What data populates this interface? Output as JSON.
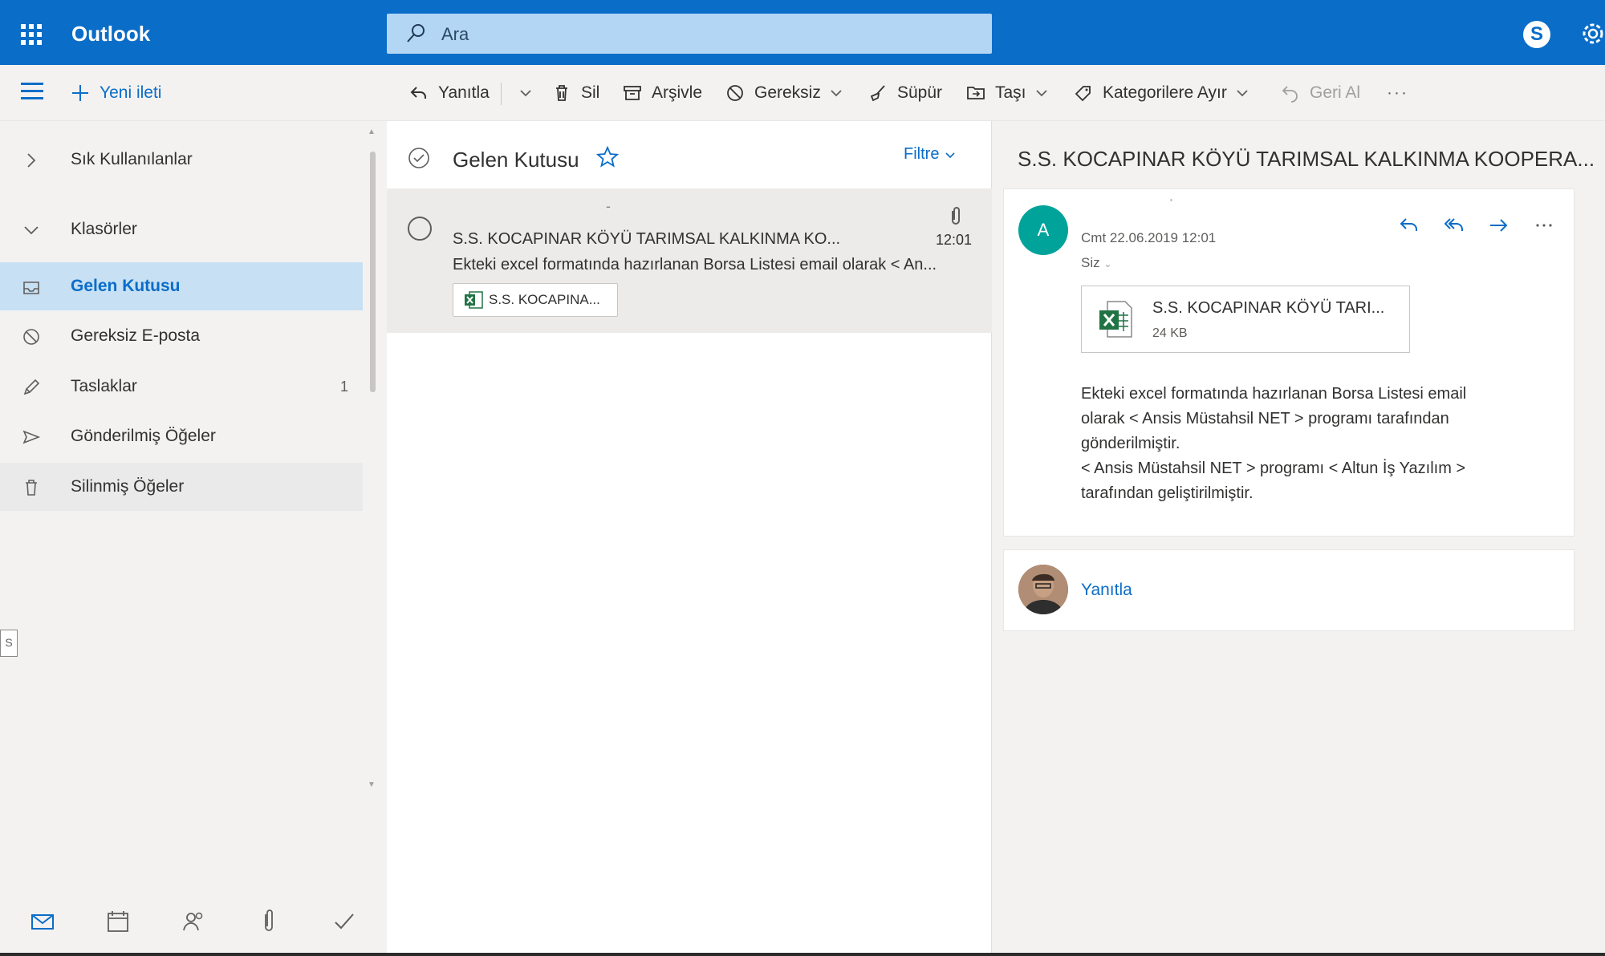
{
  "topbar": {
    "app_name": "Outlook",
    "search_placeholder": "Ara",
    "icons": [
      "app-launcher-icon",
      "search-icon",
      "skype-icon",
      "settings-gear-icon"
    ],
    "brand_color": "#0a6dc8"
  },
  "commandbar": {
    "new_message": "Yeni ileti",
    "reply": "Yanıtla",
    "delete": "Sil",
    "archive": "Arşivle",
    "junk": "Gereksiz",
    "sweep": "Süpür",
    "move": "Taşı",
    "categorize": "Kategorilere Ayır",
    "undo": "Geri Al",
    "more": "···"
  },
  "sidebar": {
    "favorites": "Sık Kullanılanlar",
    "folders": "Klasörler",
    "items": [
      {
        "label": "Gelen Kutusu",
        "icon": "inbox-icon",
        "selected": true
      },
      {
        "label": "Gereksiz E-posta",
        "icon": "blocked-icon"
      },
      {
        "label": "Taslaklar",
        "icon": "pencil-icon",
        "count": "1"
      },
      {
        "label": "Gönderilmiş Öğeler",
        "icon": "send-icon"
      },
      {
        "label": "Silinmiş Öğeler",
        "icon": "trash-icon"
      }
    ],
    "small_tab": "S",
    "bottom_apps": [
      "mail-icon",
      "calendar-icon",
      "people-icon",
      "files-icon",
      "todo-icon"
    ]
  },
  "message_list": {
    "folder_title": "Gelen Kutusu",
    "filter_label": "Filtre",
    "messages": [
      {
        "subject": "S.S. KOCAPINAR KÖYÜ TARIMSAL KALKINMA KO...",
        "time": "12:01",
        "preview": "Ekteki excel formatında hazırlanan Borsa Listesi email olarak < An...",
        "attachment": "S.S. KOCAPINA..."
      }
    ]
  },
  "reading_pane": {
    "subject": "S.S. KOCAPINAR KÖYÜ TARIMSAL KALKINMA KOOPERA...",
    "sender_initial": "A",
    "date": "Cmt 22.06.2019 12:01",
    "to": "Siz",
    "attachment_name": "S.S. KOCAPINAR KÖYÜ TARI...",
    "attachment_size": "24 KB",
    "body_lines": [
      "Ekteki excel formatında hazırlanan Borsa Listesi email",
      "olarak < Ansis Müstahsil NET > programı tarafından",
      "gönderilmiştir.",
      "< Ansis Müstahsil NET > programı < Altun İş Yazılım >",
      "tarafından geliştirilmiştir."
    ],
    "reply_label": "Yanıtla",
    "avatar_color": "#00a39a"
  }
}
